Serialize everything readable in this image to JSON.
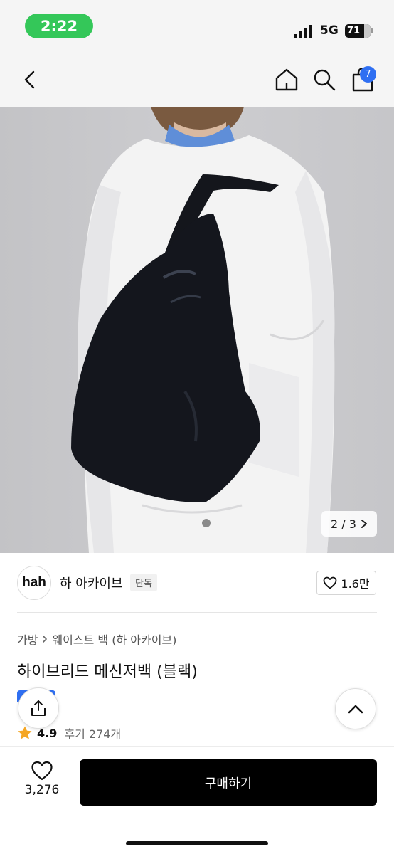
{
  "status_bar": {
    "time": "2:22",
    "network": "5G",
    "battery": "71"
  },
  "nav": {
    "cart_count": "7"
  },
  "image": {
    "counter_text": "2 / 3"
  },
  "brand": {
    "logo_text": "hah",
    "name": "하 아카이브",
    "badge": "단독",
    "likes": "1.6만"
  },
  "product": {
    "breadcrumb": [
      "가방",
      "웨이스트 백 (하 아카이브)"
    ],
    "title": "하이브리드 메신저백 (블랙)",
    "rating": "4.9",
    "reviews": "후기 274개"
  },
  "bottom": {
    "wish_count": "3,276",
    "buy_label": "구매하기"
  },
  "colors": {
    "status_green": "#34c759",
    "accent_blue": "#2f6ff2",
    "star": "#f5a623",
    "buy_button": "#000000"
  }
}
